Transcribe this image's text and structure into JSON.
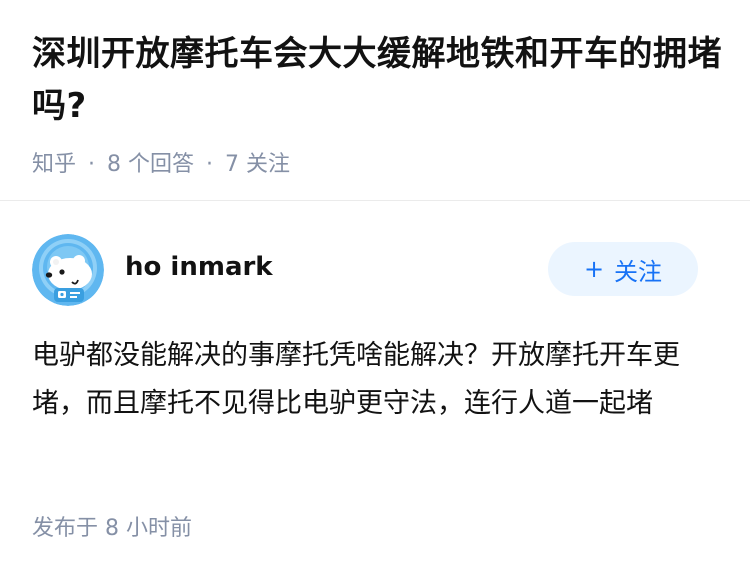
{
  "question": {
    "title": "深圳开放摩托车会大大缓解地铁和开车的拥堵吗?",
    "source": "知乎",
    "separator": "·",
    "answer_count": "8 个回答",
    "follower_count": "7 关注"
  },
  "answer": {
    "author": {
      "name": "ho inmark",
      "avatar_icon": "polar-bear-astronaut-avatar"
    },
    "follow_button": {
      "icon": "+",
      "label": "关注"
    },
    "content": "电驴都没能解决的事摩托凭啥能解决？开放摩托开车更堵，而且摩托不见得比电驴更守法，连行人道一起堵",
    "posted": "发布于 8 小时前"
  },
  "colors": {
    "title": "#121212",
    "meta": "#8590a6",
    "accent": "#1772f6",
    "follow_bg": "#ebf5ff",
    "divider": "#ebebeb"
  }
}
